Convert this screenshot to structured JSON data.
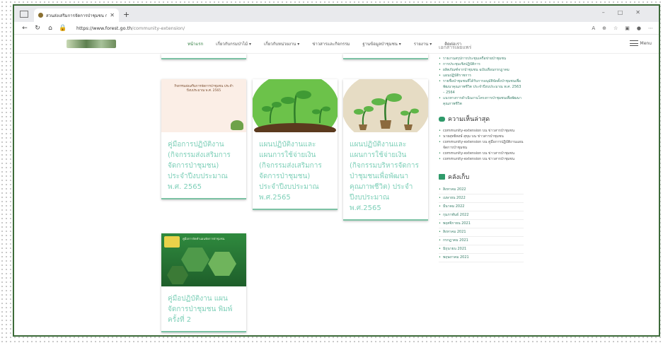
{
  "browser": {
    "tab_title": "สวนส่งเสริมการจัดการป่าชุมชน กรมป่าไม้",
    "url_prefix": "https://www.forest.go.th",
    "url_path": "/community-extension/"
  },
  "site": {
    "menu": [
      {
        "label": "หน้าแรก",
        "active": true
      },
      {
        "label": "เกี่ยวกับกรมป่าไม้ ▾",
        "active": false
      },
      {
        "label": "เกี่ยวกับหน่วยงาน ▾",
        "active": false
      },
      {
        "label": "ข่าวสารและกิจกรรม",
        "active": false
      },
      {
        "label": "ฐานข้อมูลป่าชุมชน ▾",
        "active": false
      },
      {
        "label": "รายงาน ▾",
        "active": false
      },
      {
        "label": "ติดต่อเรา",
        "active": false
      }
    ],
    "menu_label": "Menu"
  },
  "cards": [
    {
      "title": "คู่มือการปฏิบัติงาน (กิจกรรมส่งเสริมการจัดการป่าชุมชน) ประจำปีงบประมาณ พ.ศ. 2565",
      "image_text": "กิจกรรมส่งเสริมการจัดการป่าชุมชน ประจำปีงบประมาณ พ.ศ. 2565"
    },
    {
      "title": "แผนปฏิบัติงานและแผนการใช้จ่ายเงิน (กิจกรรมส่งเสริมการจัดการป่าชุมชน) ประจำปีงบประมาณ พ.ศ.2565"
    },
    {
      "title": "แผนปฏิบัติงานและแผนการใช้จ่ายเงิน (กิจกรรมบริหารจัดการป่าชุมชนเพื่อพัฒนาคุณภาพชีวิต) ประจำปีงบประมาณ พ.ศ.2565"
    },
    {
      "title": "คู่มือปฏิบัติงาน แผนจัดการป่าชุมชน พิมพ์ครั้งที่ 2",
      "image_text": "คู่มือการจัดทำแผนจัดการป่าชุมชน"
    }
  ],
  "sidebar": {
    "top_fragment": "เอกสารเผยแพร่",
    "links": [
      "รายงานสรุปการประชุมเครือข่ายป่าชุมชน",
      "การประชุมเชิงปฏิบัติการ",
      "ผลิตภัณฑ์จากป่าชุมชน ฉบับเดือนกรกฎาคม",
      "แผนปฏิบัติราชการ",
      "รายชื่อป่าชุมชนที่ได้รับการอนุมัติจัดตั้งป่าชุมชนเพื่อพัฒนาคุณภาพชีวิต ประจำปีงบประมาณ พ.ศ. 2563 – 2564",
      "แนวทางการดำเนินงานโครงการป่าชุมชนเพื่อพัฒนาคุณภาพชีวิต"
    ],
    "comments_title": "ความเห็นล่าสุด",
    "comments": [
      "community-extension บน ข่าวสารป่าชุมชน",
      "นายสุทธิพงษ์ สุขุม บน ข่าวสารป่าชุมชน",
      "community-extension บน คู่มือการปฏิบัติงานแผนจัดการป่าชุมชน",
      "community-extension บน ข่าวสารป่าชุมชน",
      "community-extension บน ข่าวสารป่าชุมชน"
    ],
    "archives_title": "คลังเก็บ",
    "archives": [
      "สิงหาคม 2022",
      "เมษายน 2022",
      "มีนาคม 2022",
      "กุมภาพันธ์ 2022",
      "พฤศจิกายน 2021",
      "สิงหาคม 2021",
      "กรกฎาคม 2021",
      "มิถุนายน 2021",
      "พฤษภาคม 2021"
    ]
  }
}
